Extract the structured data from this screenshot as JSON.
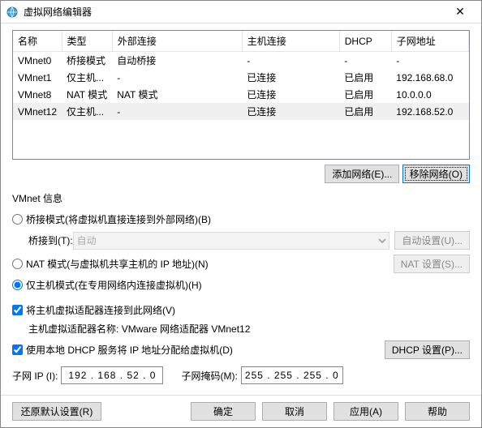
{
  "window": {
    "title": "虚拟网络编辑器"
  },
  "table": {
    "headers": {
      "name": "名称",
      "type": "类型",
      "ext": "外部连接",
      "host": "主机连接",
      "dhcp": "DHCP",
      "subnet": "子网地址"
    },
    "rows": [
      {
        "name": "VMnet0",
        "type": "桥接模式",
        "ext": "自动桥接",
        "host": "-",
        "dhcp": "-",
        "subnet": "-"
      },
      {
        "name": "VMnet1",
        "type": "仅主机...",
        "ext": "-",
        "host": "已连接",
        "dhcp": "已启用",
        "subnet": "192.168.68.0"
      },
      {
        "name": "VMnet8",
        "type": "NAT 模式",
        "ext": "NAT 模式",
        "host": "已连接",
        "dhcp": "已启用",
        "subnet": "10.0.0.0"
      },
      {
        "name": "VMnet12",
        "type": "仅主机...",
        "ext": "-",
        "host": "已连接",
        "dhcp": "已启用",
        "subnet": "192.168.52.0"
      }
    ],
    "selectedIndex": 3
  },
  "buttons": {
    "addNet": "添加网络(E)...",
    "removeNet": "移除网络(O)"
  },
  "info": {
    "title": "VMnet 信息",
    "bridged": "桥接模式(将虚拟机直接连接到外部网络)(B)",
    "bridgedTo": "桥接到(T):",
    "bridgedAuto": "自动",
    "autoSet": "自动设置(U)...",
    "nat": "NAT 模式(与虚拟机共享主机的 IP 地址)(N)",
    "natSet": "NAT 设置(S)...",
    "hostOnly": "仅主机模式(在专用网络内连接虚拟机)(H)",
    "connectAdapter": "将主机虚拟适配器连接到此网络(V)",
    "adapterNameLabel": "主机虚拟适配器名称:",
    "adapterName": "VMware 网络适配器 VMnet12",
    "useDhcp": "使用本地 DHCP 服务将 IP 地址分配给虚拟机(D)",
    "dhcpSet": "DHCP 设置(P)...",
    "subnetIpLabel": "子网 IP (I):",
    "subnetIp": "192 . 168 . 52  .  0",
    "subnetMaskLabel": "子网掩码(M):",
    "subnetMask": "255 . 255 . 255 .  0"
  },
  "footer": {
    "restore": "还原默认设置(R)",
    "ok": "确定",
    "cancel": "取消",
    "apply": "应用(A)",
    "help": "帮助"
  }
}
